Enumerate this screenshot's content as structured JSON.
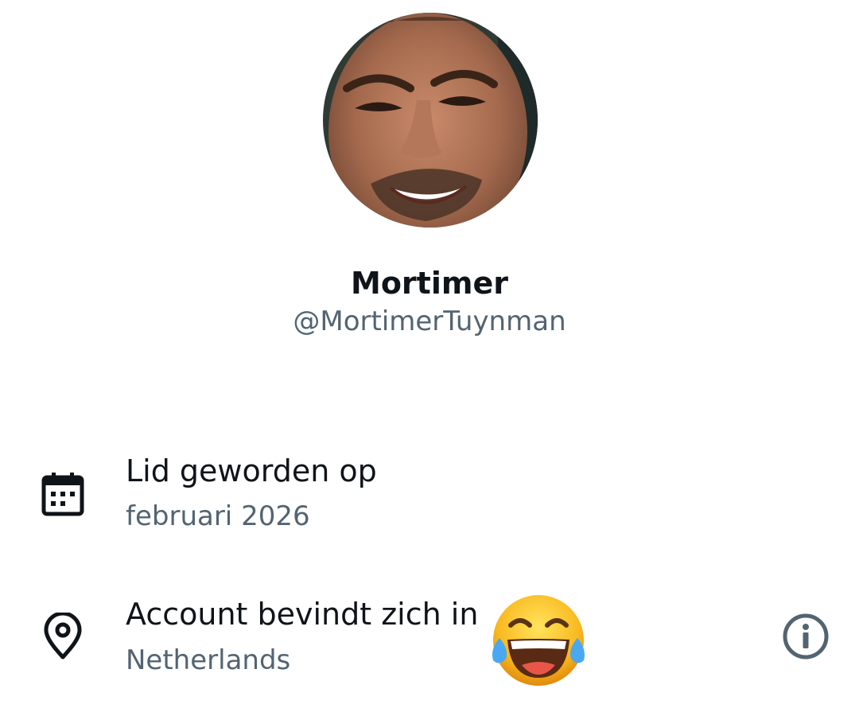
{
  "profile": {
    "display_name": "Mortimer",
    "handle": "@MortimerTuynman",
    "avatar_icon": "profile-photo"
  },
  "joined": {
    "icon": "calendar-icon",
    "title": "Lid geworden op",
    "value": "februari 2026"
  },
  "location": {
    "icon": "location-pin-icon",
    "title": "Account bevindt zich in",
    "value": "Netherlands",
    "emoji": "face-with-tears-of-joy",
    "info_icon": "info-icon"
  },
  "colors": {
    "primary_text": "#0f1419",
    "secondary_text": "#536471",
    "background": "#ffffff"
  }
}
